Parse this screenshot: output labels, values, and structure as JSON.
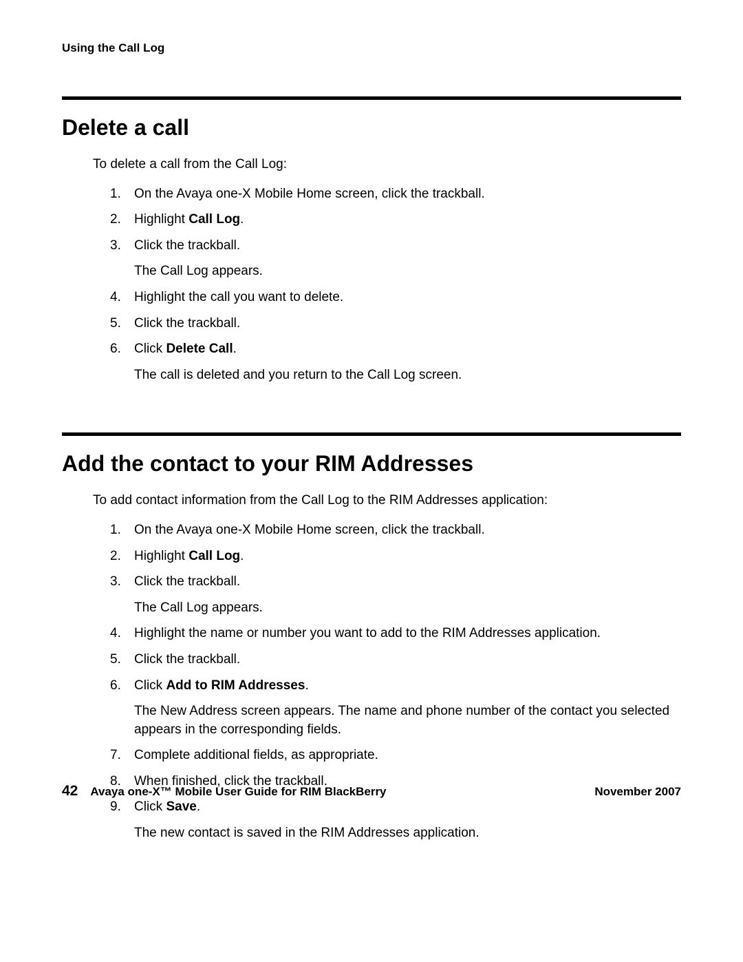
{
  "header": "Using the Call Log",
  "sections": [
    {
      "heading": "Delete a call",
      "intro": "To delete a call from the Call Log:",
      "steps": [
        {
          "num": "1.",
          "parts": [
            {
              "t": "On the Avaya one-X Mobile Home screen, click the trackball.",
              "b": false
            }
          ]
        },
        {
          "num": "2.",
          "parts": [
            {
              "t": "Highlight ",
              "b": false
            },
            {
              "t": "Call Log",
              "b": true
            },
            {
              "t": ".",
              "b": false
            }
          ]
        },
        {
          "num": "3.",
          "parts": [
            {
              "t": "Click the trackball.",
              "b": false
            }
          ],
          "sub": "The Call Log appears."
        },
        {
          "num": "4.",
          "parts": [
            {
              "t": "Highlight the call you want to delete.",
              "b": false
            }
          ]
        },
        {
          "num": "5.",
          "parts": [
            {
              "t": "Click the trackball.",
              "b": false
            }
          ]
        },
        {
          "num": "6.",
          "parts": [
            {
              "t": "Click ",
              "b": false
            },
            {
              "t": "Delete Call",
              "b": true
            },
            {
              "t": ".",
              "b": false
            }
          ],
          "sub": "The call is deleted and you return to the Call Log screen."
        }
      ]
    },
    {
      "heading": "Add the contact to your RIM Addresses",
      "intro": "To add contact information from the Call Log to the RIM Addresses application:",
      "steps": [
        {
          "num": "1.",
          "parts": [
            {
              "t": "On the Avaya one-X Mobile Home screen, click the trackball.",
              "b": false
            }
          ]
        },
        {
          "num": "2.",
          "parts": [
            {
              "t": "Highlight ",
              "b": false
            },
            {
              "t": "Call Log",
              "b": true
            },
            {
              "t": ".",
              "b": false
            }
          ]
        },
        {
          "num": "3.",
          "parts": [
            {
              "t": "Click the trackball.",
              "b": false
            }
          ],
          "sub": "The Call Log appears."
        },
        {
          "num": "4.",
          "parts": [
            {
              "t": "Highlight the name or number you want to add to the RIM Addresses application.",
              "b": false
            }
          ]
        },
        {
          "num": "5.",
          "parts": [
            {
              "t": "Click the trackball.",
              "b": false
            }
          ]
        },
        {
          "num": "6.",
          "parts": [
            {
              "t": "Click ",
              "b": false
            },
            {
              "t": "Add to RIM Addresses",
              "b": true
            },
            {
              "t": ".",
              "b": false
            }
          ],
          "sub": "The New Address screen appears. The name and phone number of the contact you selected appears in the corresponding fields."
        },
        {
          "num": "7.",
          "parts": [
            {
              "t": "Complete additional fields, as appropriate.",
              "b": false
            }
          ]
        },
        {
          "num": "8.",
          "parts": [
            {
              "t": "When finished, click the trackball.",
              "b": false
            }
          ]
        },
        {
          "num": "9.",
          "parts": [
            {
              "t": "Click ",
              "b": false
            },
            {
              "t": "Save",
              "b": true
            },
            {
              "t": ".",
              "b": false
            }
          ],
          "sub": "The new contact is saved in the RIM Addresses application."
        }
      ]
    }
  ],
  "footer": {
    "page": "42",
    "title": "Avaya one-X™ Mobile User Guide for RIM BlackBerry",
    "date": "November 2007"
  }
}
